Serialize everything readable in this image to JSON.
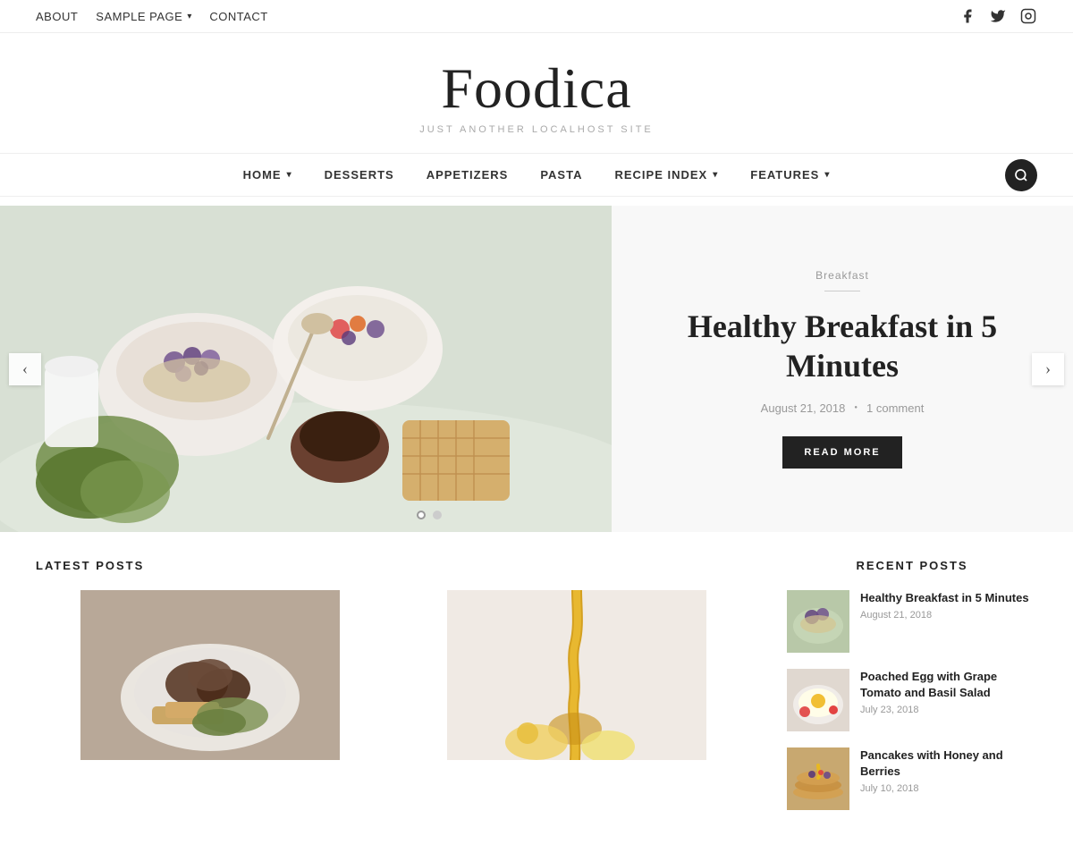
{
  "topnav": {
    "items": [
      {
        "label": "ABOUT",
        "hasDropdown": false
      },
      {
        "label": "SAMPLE PAGE",
        "hasDropdown": true
      },
      {
        "label": "CONTACT",
        "hasDropdown": false
      }
    ],
    "social": [
      "facebook",
      "twitter",
      "instagram"
    ]
  },
  "site": {
    "title": "Foodica",
    "tagline": "JUST ANOTHER LOCALHOST SITE"
  },
  "mainnav": {
    "items": [
      {
        "label": "HOME",
        "hasDropdown": true
      },
      {
        "label": "DESSERTS",
        "hasDropdown": false
      },
      {
        "label": "APPETIZERS",
        "hasDropdown": false
      },
      {
        "label": "PASTA",
        "hasDropdown": false
      },
      {
        "label": "RECIPE INDEX",
        "hasDropdown": true
      },
      {
        "label": "FEATURES",
        "hasDropdown": true
      }
    ]
  },
  "hero": {
    "category": "Breakfast",
    "title": "Healthy Breakfast in 5 Minutes",
    "date": "August 21, 2018",
    "comments": "1 comment",
    "readMoreLabel": "READ MORE",
    "slide1Active": true,
    "emoji": "🥗"
  },
  "latestPosts": {
    "sectionTitle": "LATEST POSTS"
  },
  "sidebar": {
    "sectionTitle": "RECENT POSTS",
    "posts": [
      {
        "title": "Healthy Breakfast in 5 Minutes",
        "date": "August 21, 2018",
        "thumbClass": "thumb-1"
      },
      {
        "title": "Poached Egg with Grape Tomato and Basil Salad",
        "date": "July 23, 2018",
        "thumbClass": "thumb-2"
      },
      {
        "title": "Pancakes with Honey and Berries",
        "date": "July 10, 2018",
        "thumbClass": "thumb-3"
      }
    ]
  }
}
